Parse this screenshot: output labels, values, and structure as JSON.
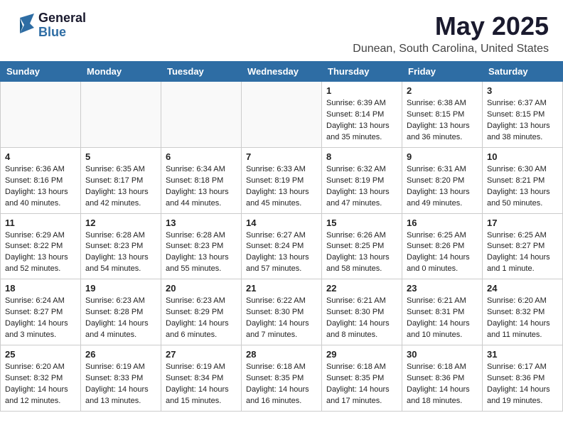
{
  "header": {
    "logo": {
      "general": "General",
      "blue": "Blue"
    },
    "title": "May 2025",
    "location": "Dunean, South Carolina, United States"
  },
  "days_of_week": [
    "Sunday",
    "Monday",
    "Tuesday",
    "Wednesday",
    "Thursday",
    "Friday",
    "Saturday"
  ],
  "weeks": [
    [
      {
        "day": "",
        "info": ""
      },
      {
        "day": "",
        "info": ""
      },
      {
        "day": "",
        "info": ""
      },
      {
        "day": "",
        "info": ""
      },
      {
        "day": "1",
        "info": "Sunrise: 6:39 AM\nSunset: 8:14 PM\nDaylight: 13 hours\nand 35 minutes."
      },
      {
        "day": "2",
        "info": "Sunrise: 6:38 AM\nSunset: 8:15 PM\nDaylight: 13 hours\nand 36 minutes."
      },
      {
        "day": "3",
        "info": "Sunrise: 6:37 AM\nSunset: 8:15 PM\nDaylight: 13 hours\nand 38 minutes."
      }
    ],
    [
      {
        "day": "4",
        "info": "Sunrise: 6:36 AM\nSunset: 8:16 PM\nDaylight: 13 hours\nand 40 minutes."
      },
      {
        "day": "5",
        "info": "Sunrise: 6:35 AM\nSunset: 8:17 PM\nDaylight: 13 hours\nand 42 minutes."
      },
      {
        "day": "6",
        "info": "Sunrise: 6:34 AM\nSunset: 8:18 PM\nDaylight: 13 hours\nand 44 minutes."
      },
      {
        "day": "7",
        "info": "Sunrise: 6:33 AM\nSunset: 8:19 PM\nDaylight: 13 hours\nand 45 minutes."
      },
      {
        "day": "8",
        "info": "Sunrise: 6:32 AM\nSunset: 8:19 PM\nDaylight: 13 hours\nand 47 minutes."
      },
      {
        "day": "9",
        "info": "Sunrise: 6:31 AM\nSunset: 8:20 PM\nDaylight: 13 hours\nand 49 minutes."
      },
      {
        "day": "10",
        "info": "Sunrise: 6:30 AM\nSunset: 8:21 PM\nDaylight: 13 hours\nand 50 minutes."
      }
    ],
    [
      {
        "day": "11",
        "info": "Sunrise: 6:29 AM\nSunset: 8:22 PM\nDaylight: 13 hours\nand 52 minutes."
      },
      {
        "day": "12",
        "info": "Sunrise: 6:28 AM\nSunset: 8:23 PM\nDaylight: 13 hours\nand 54 minutes."
      },
      {
        "day": "13",
        "info": "Sunrise: 6:28 AM\nSunset: 8:23 PM\nDaylight: 13 hours\nand 55 minutes."
      },
      {
        "day": "14",
        "info": "Sunrise: 6:27 AM\nSunset: 8:24 PM\nDaylight: 13 hours\nand 57 minutes."
      },
      {
        "day": "15",
        "info": "Sunrise: 6:26 AM\nSunset: 8:25 PM\nDaylight: 13 hours\nand 58 minutes."
      },
      {
        "day": "16",
        "info": "Sunrise: 6:25 AM\nSunset: 8:26 PM\nDaylight: 14 hours\nand 0 minutes."
      },
      {
        "day": "17",
        "info": "Sunrise: 6:25 AM\nSunset: 8:27 PM\nDaylight: 14 hours\nand 1 minute."
      }
    ],
    [
      {
        "day": "18",
        "info": "Sunrise: 6:24 AM\nSunset: 8:27 PM\nDaylight: 14 hours\nand 3 minutes."
      },
      {
        "day": "19",
        "info": "Sunrise: 6:23 AM\nSunset: 8:28 PM\nDaylight: 14 hours\nand 4 minutes."
      },
      {
        "day": "20",
        "info": "Sunrise: 6:23 AM\nSunset: 8:29 PM\nDaylight: 14 hours\nand 6 minutes."
      },
      {
        "day": "21",
        "info": "Sunrise: 6:22 AM\nSunset: 8:30 PM\nDaylight: 14 hours\nand 7 minutes."
      },
      {
        "day": "22",
        "info": "Sunrise: 6:21 AM\nSunset: 8:30 PM\nDaylight: 14 hours\nand 8 minutes."
      },
      {
        "day": "23",
        "info": "Sunrise: 6:21 AM\nSunset: 8:31 PM\nDaylight: 14 hours\nand 10 minutes."
      },
      {
        "day": "24",
        "info": "Sunrise: 6:20 AM\nSunset: 8:32 PM\nDaylight: 14 hours\nand 11 minutes."
      }
    ],
    [
      {
        "day": "25",
        "info": "Sunrise: 6:20 AM\nSunset: 8:32 PM\nDaylight: 14 hours\nand 12 minutes."
      },
      {
        "day": "26",
        "info": "Sunrise: 6:19 AM\nSunset: 8:33 PM\nDaylight: 14 hours\nand 13 minutes."
      },
      {
        "day": "27",
        "info": "Sunrise: 6:19 AM\nSunset: 8:34 PM\nDaylight: 14 hours\nand 15 minutes."
      },
      {
        "day": "28",
        "info": "Sunrise: 6:18 AM\nSunset: 8:35 PM\nDaylight: 14 hours\nand 16 minutes."
      },
      {
        "day": "29",
        "info": "Sunrise: 6:18 AM\nSunset: 8:35 PM\nDaylight: 14 hours\nand 17 minutes."
      },
      {
        "day": "30",
        "info": "Sunrise: 6:18 AM\nSunset: 8:36 PM\nDaylight: 14 hours\nand 18 minutes."
      },
      {
        "day": "31",
        "info": "Sunrise: 6:17 AM\nSunset: 8:36 PM\nDaylight: 14 hours\nand 19 minutes."
      }
    ]
  ]
}
